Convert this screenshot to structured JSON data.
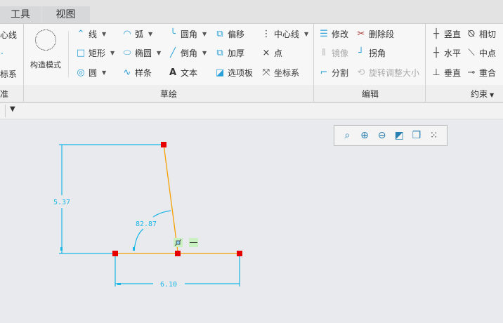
{
  "tabs": [
    {
      "label": "工具"
    },
    {
      "label": "视图"
    }
  ],
  "ribbon": {
    "datum_partial": {
      "items": [
        "心线",
        "",
        "标系"
      ],
      "label": "准"
    },
    "sketch": {
      "construction_mode": "构造模式",
      "items": [
        {
          "label": "线",
          "icon": "line-icon",
          "dropdown": true
        },
        {
          "label": "矩形",
          "icon": "rectangle-icon",
          "dropdown": true
        },
        {
          "label": "圆",
          "icon": "circle-icon",
          "dropdown": true
        },
        {
          "label": "弧",
          "icon": "arc-icon",
          "dropdown": true
        },
        {
          "label": "椭圆",
          "icon": "ellipse-icon",
          "dropdown": true
        },
        {
          "label": "样条",
          "icon": "spline-icon",
          "dropdown": false
        },
        {
          "label": "圆角",
          "icon": "fillet-icon",
          "dropdown": true
        },
        {
          "label": "倒角",
          "icon": "chamfer-icon",
          "dropdown": true
        },
        {
          "label": "文本",
          "icon": "text-icon",
          "dropdown": false
        },
        {
          "label": "偏移",
          "icon": "offset-icon",
          "dropdown": false
        },
        {
          "label": "加厚",
          "icon": "thicken-icon",
          "dropdown": false
        },
        {
          "label": "选项板",
          "icon": "palette-icon",
          "dropdown": false
        },
        {
          "label": "中心线",
          "icon": "centerline-icon",
          "dropdown": true
        },
        {
          "label": "点",
          "icon": "point-icon",
          "dropdown": false
        },
        {
          "label": "坐标系",
          "icon": "coordinate-system-icon",
          "dropdown": false
        }
      ],
      "label": "草绘"
    },
    "edit": {
      "items": [
        {
          "label": "修改",
          "enabled": true
        },
        {
          "label": "镜像",
          "enabled": false
        },
        {
          "label": "分割",
          "enabled": true
        },
        {
          "label": "删除段",
          "enabled": true
        },
        {
          "label": "拐角",
          "enabled": true
        },
        {
          "label": "旋转调整大小",
          "enabled": false
        }
      ],
      "label": "编辑"
    },
    "constraints": {
      "items": [
        "竖直",
        "水平",
        "垂直",
        "相切",
        "中点",
        "重合"
      ],
      "label": "约束"
    }
  },
  "sketch": {
    "dim_vertical": "5.37",
    "dim_horizontal": "6.10",
    "dim_angle": "82.87"
  },
  "colors": {
    "dimension": "#19b6e6",
    "selected": "#f5a000",
    "point": "#e60000"
  }
}
